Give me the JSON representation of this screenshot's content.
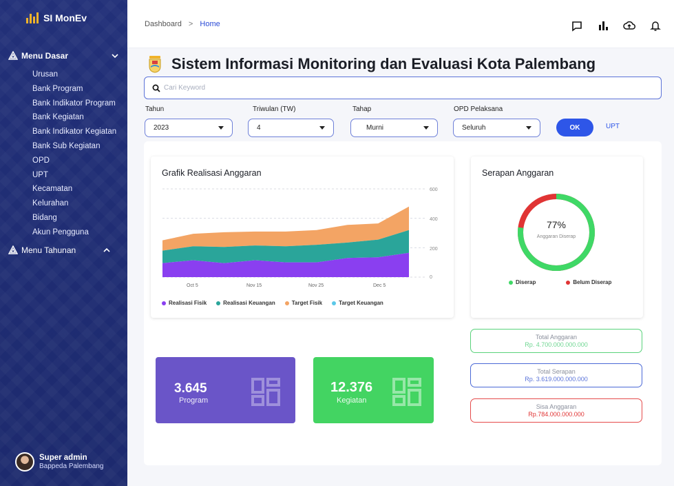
{
  "app": {
    "title": "SI MonEv"
  },
  "sidebar": {
    "menu_dasar": "Menu Dasar",
    "items": [
      "Urusan",
      "Bank Program",
      "Bank Indikator Program",
      "Bank Kegiatan",
      "Bank Indikator Kegiatan",
      "Bank Sub Kegiatan",
      "OPD",
      "UPT",
      "Kecamatan",
      "Kelurahan",
      "Bidang",
      "Akun Pengguna"
    ],
    "menu_tahunan": "Menu Tahunan",
    "user": {
      "name": "Super admin",
      "role": "Bappeda Palembang"
    }
  },
  "breadcrumb": {
    "root": "Dashboard",
    "separator": ">",
    "current": "Home"
  },
  "page": {
    "title": "Sistem Informasi Monitoring dan Evaluasi Kota Palembang"
  },
  "search": {
    "placeholder": "Cari Keyword"
  },
  "filters": {
    "tahun": {
      "label": "Tahun",
      "value": "2023"
    },
    "triwulan": {
      "label": "Triwulan (TW)",
      "value": "4"
    },
    "tahap": {
      "label": "Tahap",
      "value": "Murni"
    },
    "opd": {
      "label": "OPD Pelaksana",
      "value": "Seluruh"
    },
    "ok_label": "OK",
    "upt_label": "UPT"
  },
  "realisasi_chart": {
    "title": "Grafik Realisasi Anggaran",
    "x_ticks": [
      "Oct 5",
      "Nov 15",
      "Nov 25",
      "Dec 5"
    ],
    "y_ticks": [
      "600",
      "400",
      "200",
      "0"
    ],
    "legend": [
      "Realisasi Fisik",
      "Realisasi Keuangan",
      "Target Fisik",
      "Target Keuangan"
    ]
  },
  "serapan": {
    "title": "Serapan Anggaran",
    "percent_label": "77%",
    "percent": 77,
    "sub_label": "Anggaran Diserap",
    "legend_diserap": "Diserap",
    "legend_belum": "Belum Diserap"
  },
  "stats": {
    "program": {
      "value": "3.645",
      "label": "Program"
    },
    "kegiatan": {
      "value": "12.376",
      "label": "Kegiatan"
    }
  },
  "budget": {
    "total": {
      "label": "Total Anggaran",
      "value": "Rp. 4.700.000.000.000"
    },
    "serapan": {
      "label": "Total Serapan",
      "value": "Rp. 3.619.000.000.000"
    },
    "sisa": {
      "label": "Sisa Anggaran",
      "value": "Rp.784.000.000.000"
    }
  },
  "colors": {
    "realisasi_fisik": "#8a3ff0",
    "realisasi_keuangan": "#2aa59a",
    "target_fisik": "#f3a464",
    "target_keuangan": "#5bc8e8",
    "diserap": "#3fd866",
    "belum_diserap": "#e03434",
    "program_card": "#6a55c8",
    "kegiatan_card": "#43d462"
  },
  "chart_data": {
    "type": "area",
    "title": "Grafik Realisasi Anggaran",
    "x": [
      "Oct 5",
      "",
      "",
      "Nov 15",
      "",
      "Nov 25",
      "",
      "Dec 5",
      ""
    ],
    "ylim": [
      0,
      600
    ],
    "stacked": true,
    "legend_position": "bottom",
    "series": [
      {
        "name": "Realisasi Fisik",
        "values": [
          95,
          115,
          95,
          115,
          100,
          100,
          130,
          135,
          165
        ]
      },
      {
        "name": "Realisasi Keuangan",
        "values": [
          85,
          95,
          110,
          100,
          110,
          120,
          105,
          120,
          155
        ]
      },
      {
        "name": "Target Fisik",
        "values": [
          70,
          85,
          100,
          95,
          100,
          100,
          120,
          110,
          160
        ]
      }
    ]
  }
}
